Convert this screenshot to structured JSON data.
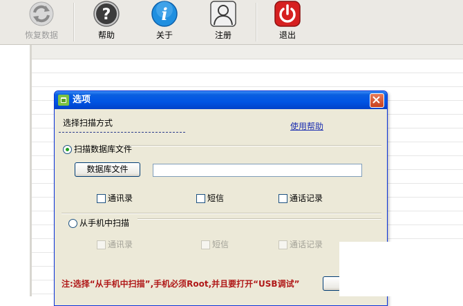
{
  "toolbar": {
    "items": [
      {
        "label": "恢复数据",
        "icon": "refresh-icon",
        "enabled": false
      },
      {
        "label": "帮助",
        "icon": "question-icon",
        "enabled": true
      },
      {
        "label": "关于",
        "icon": "info-icon",
        "enabled": true
      },
      {
        "label": "注册",
        "icon": "user-icon",
        "enabled": true
      },
      {
        "label": "退出",
        "icon": "power-icon",
        "enabled": true
      }
    ]
  },
  "dialog": {
    "title": "选项",
    "scan_mode_label": "选择扫描方式",
    "help_link": "使用帮助",
    "option_db": {
      "label": "扫描数据库文件",
      "selected": true,
      "db_button": "数据库文件",
      "path_value": "",
      "checkboxes": [
        "通讯录",
        "短信",
        "通话记录"
      ]
    },
    "option_phone": {
      "label": "从手机中扫描",
      "selected": false,
      "checkboxes": [
        "通讯录",
        "短信",
        "通话记录"
      ]
    },
    "note": "注:选择“从手机中扫描”,手机必须Root,并且要打开“USB调试”"
  },
  "colors": {
    "titlebar": "#0054e3",
    "note_text": "#b01818",
    "link": "#1c2fb0",
    "dialog_bg": "#ece9d8"
  }
}
